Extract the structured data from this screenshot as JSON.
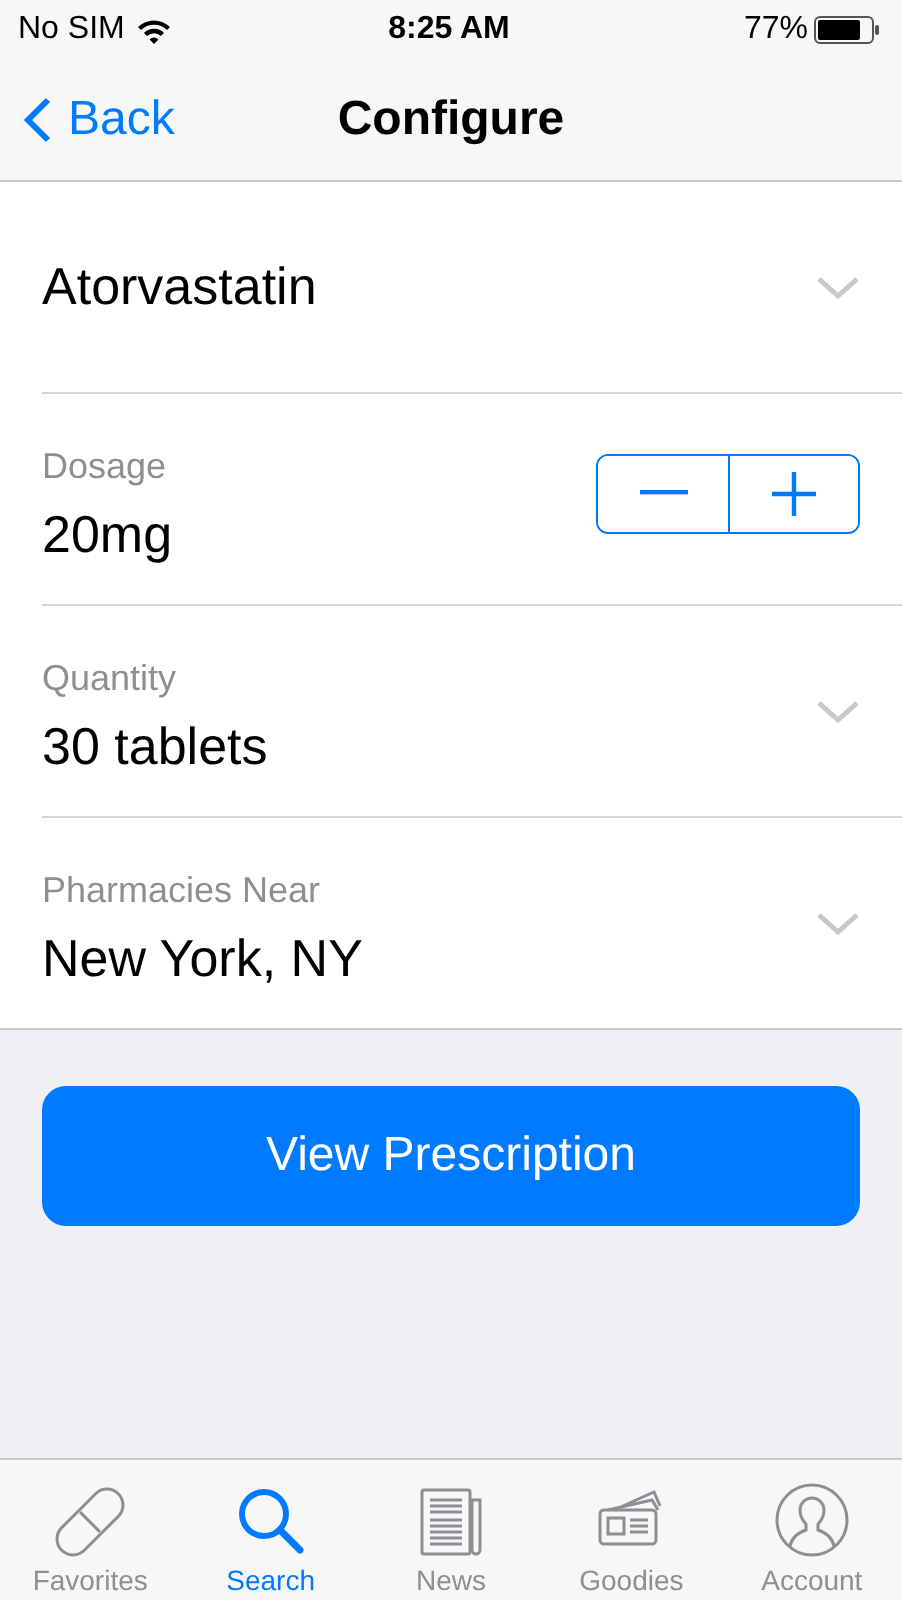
{
  "status_bar": {
    "carrier": "No SIM",
    "time": "8:25 AM",
    "battery": "77%"
  },
  "nav": {
    "back": "Back",
    "title": "Configure"
  },
  "fields": [
    {
      "kind": "select",
      "value": "Atorvastatin"
    },
    {
      "kind": "stepper",
      "label": "Dosage",
      "value": "20mg"
    },
    {
      "kind": "select",
      "label": "Quantity",
      "value": "30 tablets"
    },
    {
      "kind": "select",
      "label": "Pharmacies Near",
      "value": "New York, NY"
    }
  ],
  "primary_button": "View Prescription",
  "tabs": [
    {
      "label": "Favorites",
      "selected": false
    },
    {
      "label": "Search",
      "selected": true
    },
    {
      "label": "News",
      "selected": false
    },
    {
      "label": "Goodies",
      "selected": false
    },
    {
      "label": "Account",
      "selected": false
    }
  ]
}
